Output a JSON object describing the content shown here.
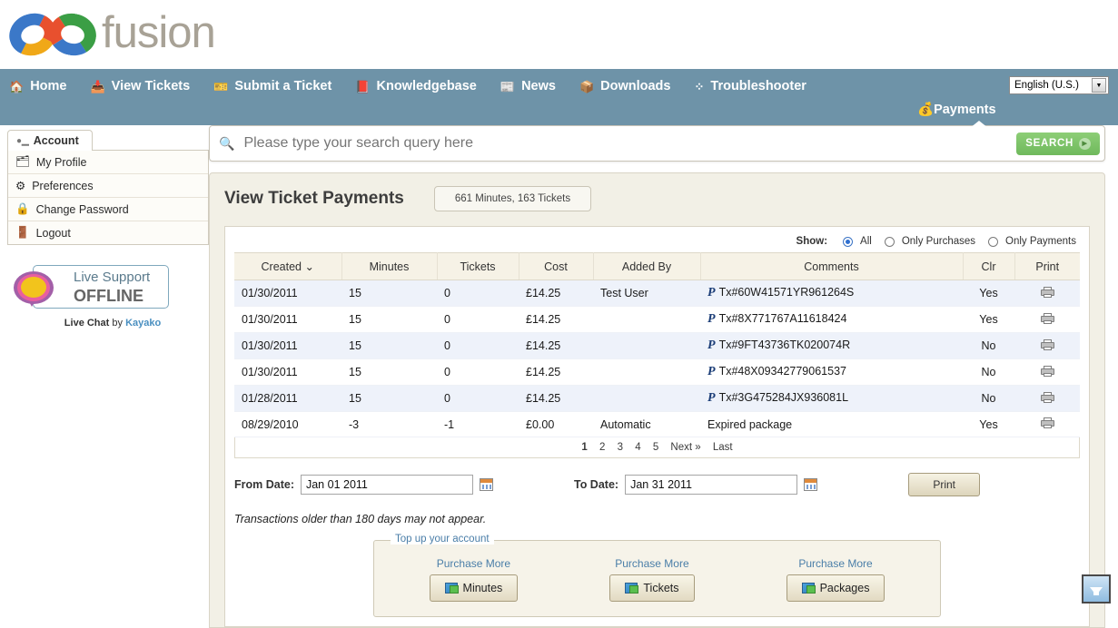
{
  "brand": {
    "name": "fusion",
    "logo_icon": "fusion-rings-logo"
  },
  "nav": {
    "items": [
      {
        "label": "Home",
        "icon": "home-icon"
      },
      {
        "label": "View Tickets",
        "icon": "inbox-icon"
      },
      {
        "label": "Submit a Ticket",
        "icon": "ticket-icon"
      },
      {
        "label": "Knowledgebase",
        "icon": "books-icon"
      },
      {
        "label": "News",
        "icon": "newspaper-icon"
      },
      {
        "label": "Downloads",
        "icon": "box-icon"
      },
      {
        "label": "Troubleshooter",
        "icon": "nodes-icon"
      }
    ],
    "payments": {
      "label": "Payments",
      "icon": "payments-icon",
      "active": true
    },
    "language": {
      "value": "English (U.S.)",
      "icon": "chevron-down-icon"
    }
  },
  "sidebar": {
    "tab": {
      "label": "Account",
      "icon": "user-icon"
    },
    "items": [
      {
        "label": "My Profile",
        "icon": "profile-icon"
      },
      {
        "label": "Preferences",
        "icon": "gear-icon"
      },
      {
        "label": "Change Password",
        "icon": "lock-icon"
      },
      {
        "label": "Logout",
        "icon": "door-icon"
      }
    ],
    "live_support": {
      "title": "Live Support",
      "status": "OFFLINE"
    },
    "credit": {
      "prefix": "Live Chat",
      "middle": "by",
      "vendor": "Kayako"
    }
  },
  "search": {
    "placeholder": "Please type your search query here",
    "value": "",
    "button": "SEARCH",
    "icon": "search-icon"
  },
  "main": {
    "title": "View Ticket Payments",
    "stat_pill": "661 Minutes, 163 Tickets",
    "show": {
      "label": "Show:",
      "options": [
        {
          "label": "All",
          "selected": true
        },
        {
          "label": "Only Purchases",
          "selected": false
        },
        {
          "label": "Only Payments",
          "selected": false
        }
      ]
    },
    "table": {
      "columns": [
        "Created",
        "Minutes",
        "Tickets",
        "Cost",
        "Added By",
        "Comments",
        "Clr",
        "Print"
      ],
      "sort_column": "Created",
      "sort_icon": "chevron-down-icon",
      "rows": [
        {
          "created": "01/30/2011",
          "minutes": "15",
          "tickets": "0",
          "cost": "£14.25",
          "added_by": "Test User",
          "paypal": true,
          "comments": "Tx#60W41571YR961264S",
          "clr": "Yes",
          "negative": false
        },
        {
          "created": "01/30/2011",
          "minutes": "15",
          "tickets": "0",
          "cost": "£14.25",
          "added_by": "",
          "paypal": true,
          "comments": "Tx#8X771767A11618424",
          "clr": "Yes",
          "negative": false
        },
        {
          "created": "01/30/2011",
          "minutes": "15",
          "tickets": "0",
          "cost": "£14.25",
          "added_by": "",
          "paypal": true,
          "comments": "Tx#9FT43736TK020074R",
          "clr": "No",
          "negative": false
        },
        {
          "created": "01/30/2011",
          "minutes": "15",
          "tickets": "0",
          "cost": "£14.25",
          "added_by": "",
          "paypal": true,
          "comments": "Tx#48X09342779061537",
          "clr": "No",
          "negative": false
        },
        {
          "created": "01/28/2011",
          "minutes": "15",
          "tickets": "0",
          "cost": "£14.25",
          "added_by": "",
          "paypal": true,
          "comments": "Tx#3G475284JX936081L",
          "clr": "No",
          "negative": false
        },
        {
          "created": "08/29/2010",
          "minutes": "-3",
          "tickets": "-1",
          "cost": "£0.00",
          "added_by": "Automatic",
          "paypal": false,
          "comments": "Expired package",
          "clr": "Yes",
          "negative": true
        }
      ]
    },
    "pagination": {
      "pages": [
        "1",
        "2",
        "3",
        "4",
        "5"
      ],
      "current": "1",
      "next": "Next »",
      "last": "Last"
    },
    "filters": {
      "from_label": "From Date:",
      "from_value": "Jan 01 2011",
      "to_label": "To Date:",
      "to_value": "Jan 31 2011",
      "calendar_icon": "calendar-icon",
      "print_button": "Print"
    },
    "note": "Transactions older than 180 days may not appear.",
    "topup": {
      "legend": "Top up your account",
      "columns": [
        {
          "link": "Purchase More",
          "button": "Minutes",
          "icon": "purchase-icon"
        },
        {
          "link": "Purchase More",
          "button": "Tickets",
          "icon": "purchase-icon"
        },
        {
          "link": "Purchase More",
          "button": "Packages",
          "icon": "purchase-icon"
        }
      ]
    }
  },
  "download_button": {
    "icon": "download-arrow-icon"
  },
  "colors": {
    "nav_bg": "#6e93a8",
    "panel_bg": "#f2f0e6",
    "search_green": "#6fb95c",
    "row_alt": "#eef2fa",
    "negative": "#d21f1f",
    "link": "#4a7ea8"
  }
}
